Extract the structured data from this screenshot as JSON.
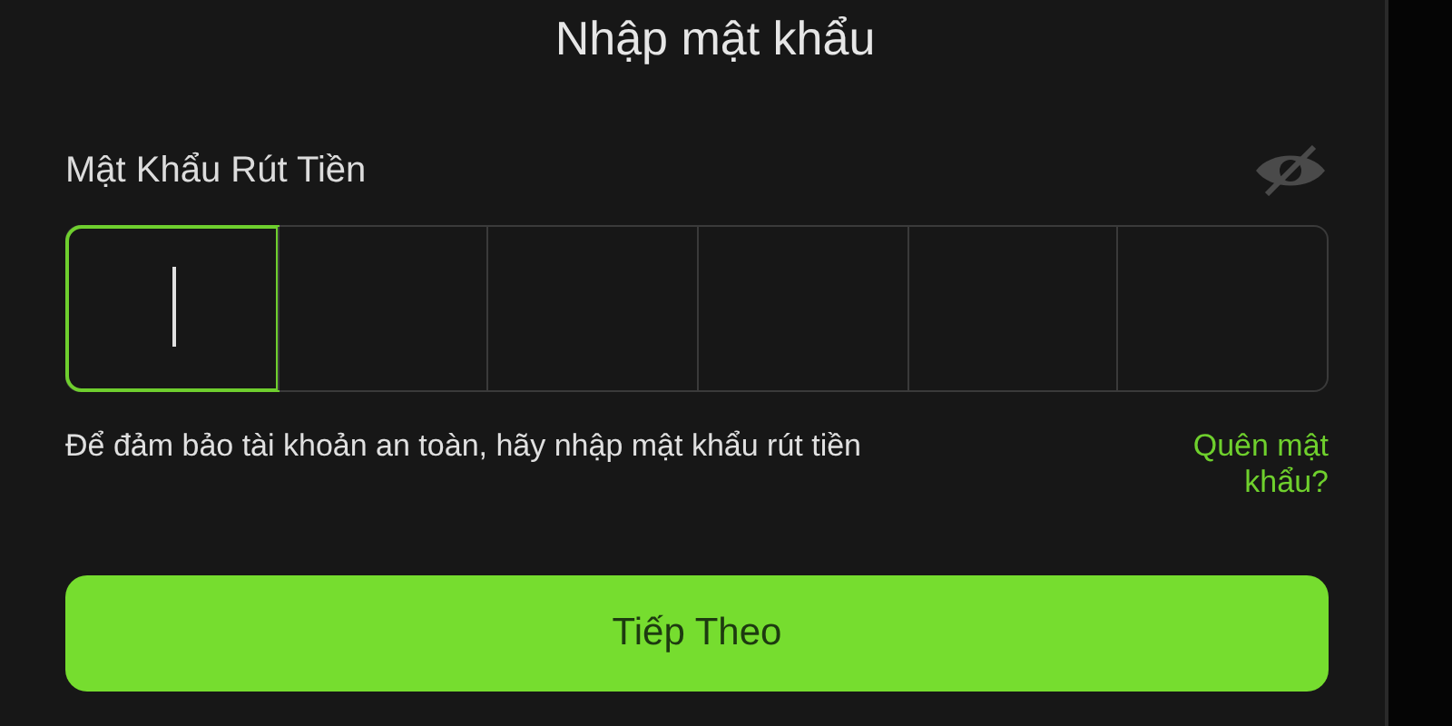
{
  "dialog": {
    "title": "Nhập mật khẩu"
  },
  "password_field": {
    "label": "Mật Khẩu Rút Tiền",
    "revealed": false,
    "cells": [
      {
        "focused": true
      },
      {
        "focused": false
      },
      {
        "focused": false
      },
      {
        "focused": false
      },
      {
        "focused": false
      },
      {
        "focused": false
      }
    ]
  },
  "hint": "Để đảm bảo tài khoản an toàn, hãy nhập mật khẩu rút tiền",
  "forgot_link": "Quên mật khẩu?",
  "buttons": [
    {
      "label": "Tiếp Theo"
    }
  ]
}
